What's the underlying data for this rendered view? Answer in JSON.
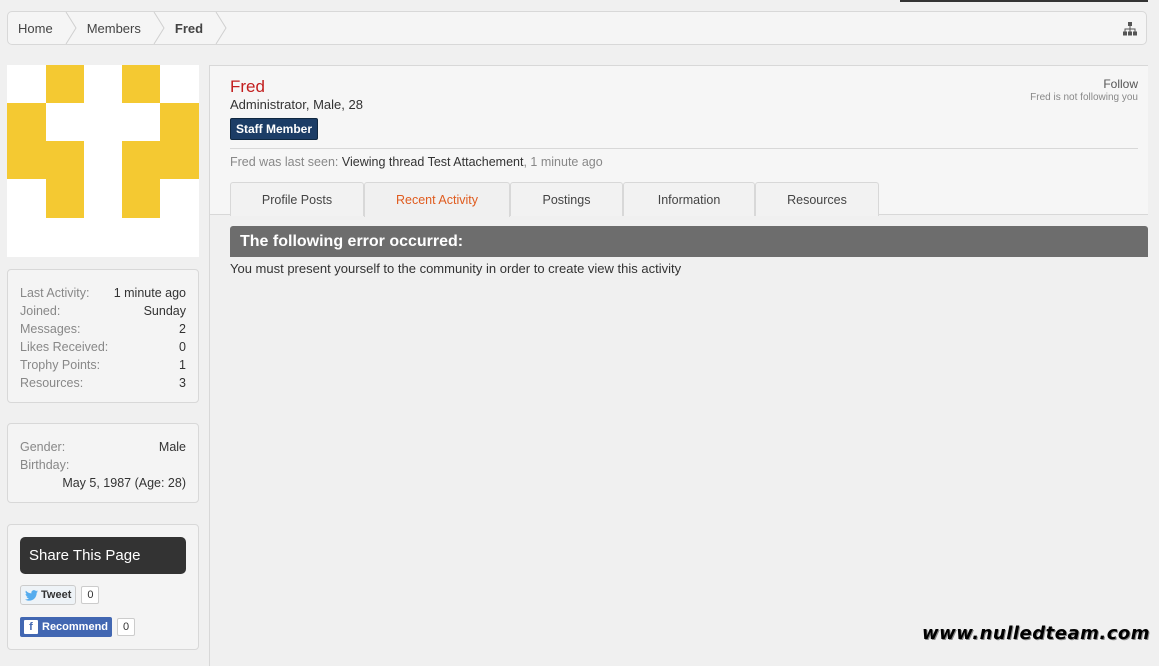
{
  "breadcrumb": {
    "items": [
      "Home",
      "Members",
      "Fred"
    ]
  },
  "icons": {
    "sitemap": "sitemap-icon",
    "tweet": "twitter-bird-icon",
    "facebook": "facebook-icon"
  },
  "avatar": {
    "colors": {
      "fill": "#f4c932",
      "background": "#ffffff"
    }
  },
  "stats": [
    {
      "label": "Last Activity:",
      "value": "1 minute ago"
    },
    {
      "label": "Joined:",
      "value": "Sunday"
    },
    {
      "label": "Messages:",
      "value": "2"
    },
    {
      "label": "Likes Received:",
      "value": "0"
    },
    {
      "label": "Trophy Points:",
      "value": "1"
    },
    {
      "label": "Resources:",
      "value": "3"
    }
  ],
  "info": {
    "gender_label": "Gender:",
    "gender_value": "Male",
    "birthday_label": "Birthday:",
    "birthday_value": "May 5, 1987 (Age: 28)"
  },
  "share": {
    "title": "Share This Page",
    "tweet_label": "Tweet",
    "tweet_count": "0",
    "recommend_label": "Recommend",
    "recommend_count": "0"
  },
  "profile": {
    "username": "Fred",
    "user_title": "Administrator, Male, 28",
    "badge": "Staff Member",
    "follow_label": "Follow",
    "follow_status": "Fred is not following you",
    "last_seen_prefix": "Fred was last seen:",
    "last_seen_activity": "Viewing thread Test Attachement",
    "last_seen_time": ", 1 minute ago"
  },
  "tabs": [
    {
      "label": "Profile Posts",
      "active": false
    },
    {
      "label": "Recent Activity",
      "active": true
    },
    {
      "label": "Postings",
      "active": false
    },
    {
      "label": "Information",
      "active": false
    },
    {
      "label": "Resources",
      "active": false
    }
  ],
  "error": {
    "heading": "The following error occurred:",
    "message": "You must present yourself to the community in order to create view this activity"
  },
  "watermark": "www.nulledteam.com",
  "colors": {
    "username": "#c21d1d",
    "active_tab": "#e05c1f",
    "badge": "#1c3d66",
    "error_header": "#6d6d6d"
  }
}
